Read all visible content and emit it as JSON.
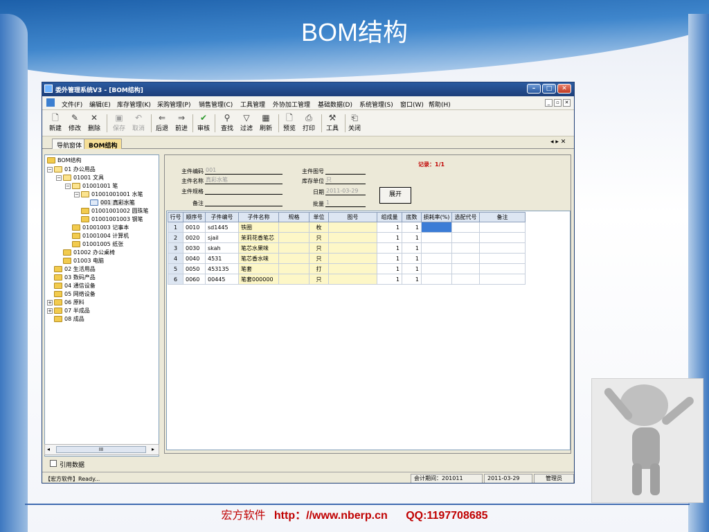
{
  "slide": {
    "title": "BOM结构",
    "footer_company": "宏方软件",
    "footer_url": "http：//www.nberp.cn",
    "footer_qq": "QQ:1197708685"
  },
  "window": {
    "title": "委外管理系统V3 - [BOM结构]"
  },
  "menubar": {
    "items": [
      "文件(F)",
      "编辑(E)",
      "库存管理(K)",
      "采购管理(P)",
      "销售管理(C)",
      "工具管理",
      "外协加工管理",
      "基础数据(D)",
      "系统管理(S)",
      "窗口(W)",
      "帮助(H)"
    ]
  },
  "toolbar": {
    "new": "新建",
    "edit": "修改",
    "delete": "删除",
    "save": "保存",
    "cancel": "取消",
    "back": "后退",
    "forward": "前进",
    "audit": "审核",
    "find": "查找",
    "filter": "过滤",
    "refresh": "刷新",
    "preview": "预览",
    "print": "打印",
    "tools": "工具",
    "close": "关闭"
  },
  "tabs": {
    "nav": "导航窗体",
    "bom": "BOM结构",
    "nav_arrows": "◂ ▸ ✕"
  },
  "tree": {
    "root": "BOM结构",
    "nodes": [
      "01  办公用品",
      "01001  文具",
      "01001001  笔",
      "01001001001  水笔",
      "001 真彩水笔",
      "01001001002  圆珠笔",
      "01001001003  钢笔",
      "01001003  记事本",
      "01001004  计算机",
      "01001005  纸张",
      "01002  办公桌椅",
      "01003  电脑",
      "02  生活用品",
      "03  数码产品",
      "04  通信设备",
      "05  网络设备",
      "06  原料",
      "07  半成品",
      "08  成品"
    ],
    "scroll_thumb": "III"
  },
  "form": {
    "parent_code_label": "主件编码",
    "parent_code": "001",
    "parent_name_label": "主件名称",
    "parent_name": "真彩水笔",
    "parent_spec_label": "主件规格",
    "parent_spec": "",
    "remark_label": "备注",
    "remark": "",
    "drawing_label": "主件图号",
    "drawing": "",
    "unit_label": "库存单位",
    "unit": "只",
    "date_label": "日期",
    "date": "2011-03-29",
    "batch_label": "批量",
    "batch": "1",
    "record": "记录：1/1",
    "expand_button": "展开"
  },
  "grid": {
    "headers": [
      "行号",
      "顺序号",
      "子件编号",
      "子件名称",
      "规格",
      "单位",
      "图号",
      "组成量",
      "底数",
      "损耗率(%)",
      "选配代号",
      "备注"
    ],
    "rows": [
      [
        "1",
        "0010",
        "sd1445",
        "铁圈",
        "",
        "枚",
        "",
        "1",
        "1",
        "",
        "",
        ""
      ],
      [
        "2",
        "0020",
        "sjail",
        "茉莉花香笔芯",
        "",
        "只",
        "",
        "1",
        "1",
        "",
        "",
        ""
      ],
      [
        "3",
        "0030",
        "skah",
        "笔芯水果味",
        "",
        "只",
        "",
        "1",
        "1",
        "",
        "",
        ""
      ],
      [
        "4",
        "0040",
        "4531",
        "笔芯香水味",
        "",
        "只",
        "",
        "1",
        "1",
        "",
        "",
        ""
      ],
      [
        "5",
        "0050",
        "453135",
        "笔套",
        "",
        "打",
        "",
        "1",
        "1",
        "",
        "",
        ""
      ],
      [
        "6",
        "0060",
        "00445",
        "笔套000000",
        "",
        "只",
        "",
        "1",
        "1",
        "",
        "",
        ""
      ]
    ]
  },
  "bottom": {
    "reference_data": "引用数据"
  },
  "statusbar": {
    "ready": "【宏方软件】Ready...",
    "period": "会计期间：201011",
    "date": "2011-03-29",
    "user": "管理员"
  }
}
